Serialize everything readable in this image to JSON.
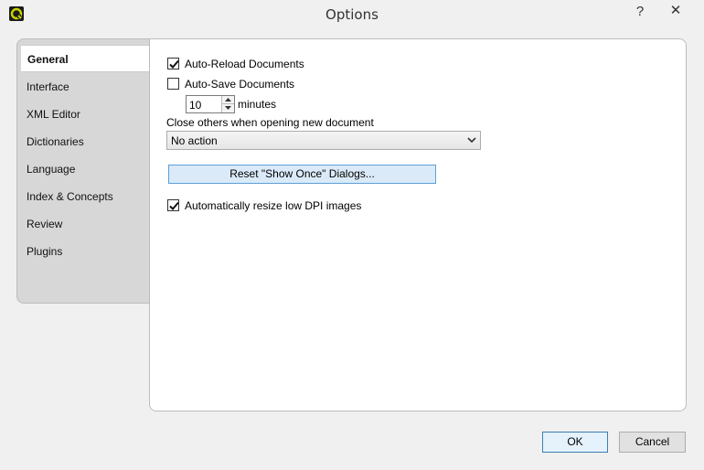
{
  "window": {
    "title": "Options",
    "help_glyph": "?",
    "close_glyph": "✕"
  },
  "tabs": [
    {
      "label": "General",
      "active": true
    },
    {
      "label": "Interface",
      "active": false
    },
    {
      "label": "XML Editor",
      "active": false
    },
    {
      "label": "Dictionaries",
      "active": false
    },
    {
      "label": "Language",
      "active": false
    },
    {
      "label": "Index & Concepts",
      "active": false
    },
    {
      "label": "Review",
      "active": false
    },
    {
      "label": "Plugins",
      "active": false
    }
  ],
  "general": {
    "auto_reload": {
      "label": "Auto-Reload Documents",
      "checked": true
    },
    "auto_save": {
      "label": "Auto-Save Documents",
      "checked": false
    },
    "interval": {
      "value": "10",
      "unit": "minutes"
    },
    "close_others_label": "Close others when opening new document",
    "close_others_select": {
      "value": "No action"
    },
    "reset_button": "Reset \"Show Once\" Dialogs...",
    "resize_dpi": {
      "label": "Automatically resize low DPI images",
      "checked": true
    }
  },
  "footer": {
    "ok": "OK",
    "cancel": "Cancel"
  },
  "icons": {
    "app": "app-logo-icon",
    "checkmark": "checkmark-icon",
    "dropdown": "chevron-down-icon"
  }
}
